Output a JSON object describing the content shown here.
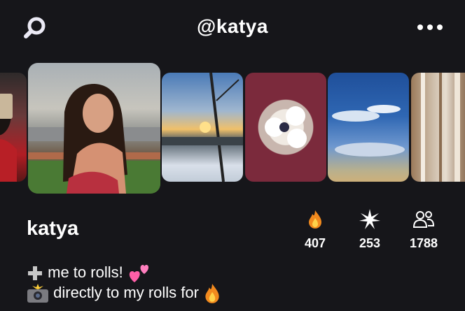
{
  "header": {
    "handle": "@katya",
    "search_icon": "search-icon",
    "more_icon": "more-dots-icon"
  },
  "profile": {
    "name": "katya",
    "stats": [
      {
        "icon": "fire-icon",
        "value": "407"
      },
      {
        "icon": "sparkle-icon",
        "value": "253"
      },
      {
        "icon": "people-icon",
        "value": "1788"
      }
    ],
    "bio": [
      {
        "lead": "plus-icon",
        "text": "me to rolls!",
        "trail": "hearts-icon"
      },
      {
        "lead": "camera-flash-icon",
        "text": "directly to my rolls for",
        "trail": "fire-icon"
      }
    ]
  },
  "photos": [
    "photo-portrait-red",
    "photo-portrait-balcony",
    "photo-sunset-snow",
    "photo-ceiling-fan",
    "photo-blue-sky",
    "photo-window-blur"
  ],
  "colors": {
    "background": "#16161a",
    "text": "#ffffff",
    "icon_accent": "#ebeaf5"
  }
}
